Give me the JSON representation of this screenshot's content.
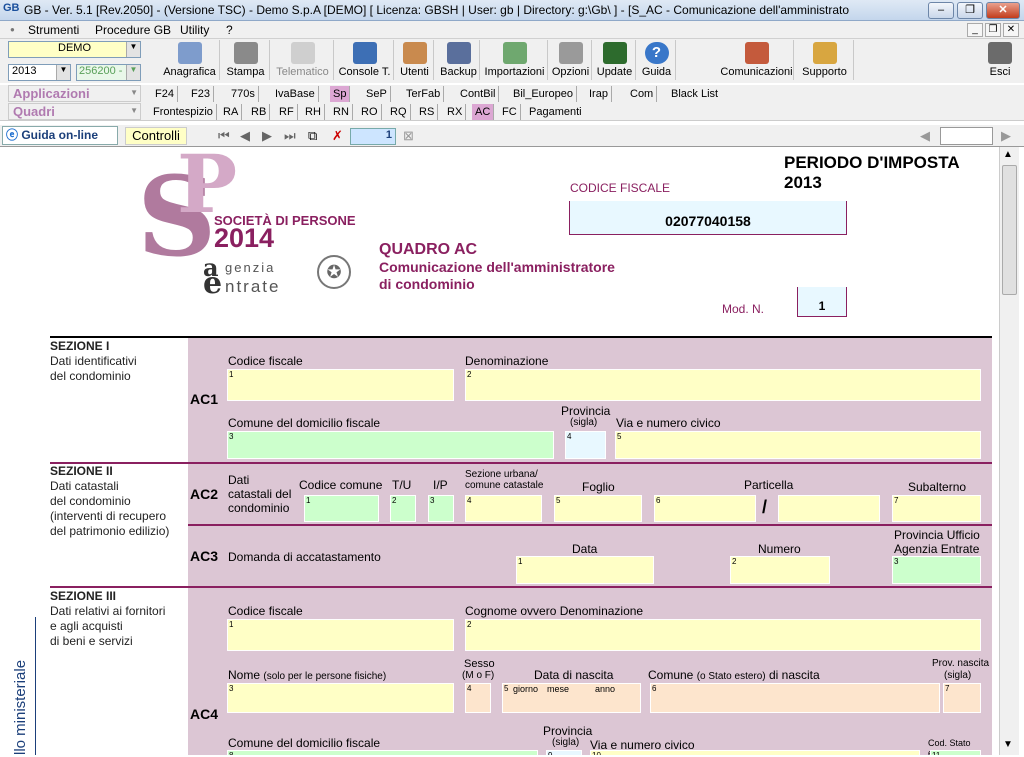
{
  "window": {
    "title": "GB - Ver. 5.1 [Rev.2050] - (Versione TSC) - Demo S.p.A [DEMO]    [ Licenza: GBSH | User: gb | Directory: g:\\Gb\\ ] - [S_AC - Comunicazione dell'amministrato",
    "app_icon": "GB"
  },
  "menu": [
    "Strumenti",
    "Procedure GB",
    "Utility",
    "?"
  ],
  "toolbar": {
    "company": "DEMO",
    "year": "2013",
    "code": "256200 -",
    "buttons": [
      "Anagrafica",
      "Stampa",
      "Telematico",
      "Console T.",
      "Utenti",
      "Backup",
      "Importazioni",
      "Opzioni",
      "Update",
      "Guida"
    ],
    "right_buttons": [
      "Comunicazioni",
      "Supporto"
    ],
    "exit": "Esci"
  },
  "left_tabs": {
    "applicazioni": "Applicazioni",
    "quadri": "Quadri"
  },
  "tabs_row1": [
    "F24",
    "F23",
    "770s",
    "IvaBase",
    "Sp",
    "SeP",
    "TerFab",
    "ContBil",
    "Bil_Europeo",
    "Irap",
    "Com",
    "Black List"
  ],
  "tabs_row2": [
    "Frontespizio",
    "RA",
    "RB",
    "RF",
    "RH",
    "RN",
    "RO",
    "RQ",
    "RS",
    "RX",
    "AC",
    "FC",
    "Pagamenti"
  ],
  "nav": {
    "guida": "Guida on-line",
    "controlli": "Controlli",
    "page": "1"
  },
  "doc": {
    "periodo": "PERIODO D'IMPOSTA 2013",
    "logo_s1": "SOCIETÀ DI PERSONE",
    "logo_year": "2014",
    "logo_agenzia": "genzia",
    "logo_entrate": "ntrate",
    "codice_fiscale_label": "CODICE FISCALE",
    "codice_fiscale": "02077040158",
    "quadro_title": "QUADRO AC",
    "quadro_sub1": "Comunicazione dell'amministratore",
    "quadro_sub2": "di condominio",
    "mod_label": "Mod. N.",
    "mod_value": "1",
    "side_label": "llo ministeriale",
    "sez1_title": "SEZIONE I",
    "sez1_desc1": "Dati identificativi",
    "sez1_desc2": "del condominio",
    "ac1": "AC1",
    "ac1_cf": "Codice fiscale",
    "ac1_den": "Denominazione",
    "ac1_comune": "Comune del domicilio fiscale",
    "ac1_prov1": "Provincia",
    "ac1_prov2": "(sigla)",
    "ac1_via": "Via e numero civico",
    "sez2_title": "SEZIONE II",
    "sez2_desc": [
      "Dati catastali",
      "del condominio",
      "(interventi di recupero",
      "del patrimonio edilizio)"
    ],
    "ac2": "AC2",
    "ac2_dati": [
      "Dati",
      "catastali del",
      "condominio"
    ],
    "ac2_codcom": "Codice comune",
    "ac2_tu": "T/U",
    "ac2_ip": "I/P",
    "ac2_sez1": "Sezione urbana/",
    "ac2_sez2": "comune catastale",
    "ac2_foglio": "Foglio",
    "ac2_particella": "Particella",
    "ac2_slash": "/",
    "ac2_sub": "Subalterno",
    "ac3": "AC3",
    "ac3_label": "Domanda di accatastamento",
    "ac3_data": "Data",
    "ac3_numero": "Numero",
    "ac3_prov1": "Provincia Ufficio",
    "ac3_prov2": "Agenzia Entrate",
    "sez3_title": "SEZIONE III",
    "sez3_desc": [
      "Dati relativi ai fornitori",
      "e agli acquisti",
      "di beni e servizi"
    ],
    "ac4": "AC4",
    "ac4_cf": "Codice fiscale",
    "ac4_cogn": "Cognome ovvero Denominazione",
    "ac4_nome": "Nome",
    "ac4_nome_small": "(solo per le persone fisiche)",
    "ac4_sesso1": "Sesso",
    "ac4_sesso2": "(M o F)",
    "ac4_data": "Data di nascita",
    "ac4_giorno": "giorno",
    "ac4_mese": "mese",
    "ac4_anno": "anno",
    "ac4_comune_a": "Comune",
    "ac4_comune_b": "(o Stato estero)",
    "ac4_comune_c": "di nascita",
    "ac4_provnasc1": "Prov. nascita",
    "ac4_provnasc2": "(sigla)",
    "ac4_domicilio": "Comune del domicilio fiscale",
    "ac4_prov1": "Provincia",
    "ac4_prov2": "(sigla)",
    "ac4_via": "Via e numero civico",
    "ac4_codstato": "Cod. Stato estero"
  }
}
